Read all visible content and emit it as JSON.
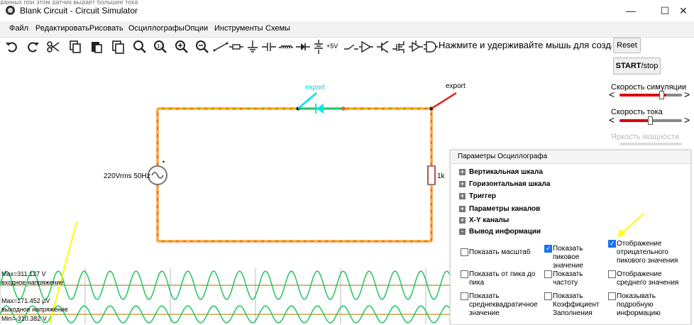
{
  "window": {
    "background_text": "данных при этом датчик выдаёт большее тока",
    "title": "Blank Circuit - Circuit Simulator",
    "controls": [
      "—",
      "☐",
      "✕"
    ]
  },
  "menu": [
    "Файл",
    "Редактировать",
    "Рисовать",
    "Осциллографы",
    "Опции",
    "Инструменты",
    "Схемы"
  ],
  "toolbar": {
    "icons": [
      "undo-icon",
      "redo-icon",
      "cut-icon",
      "copy-icon",
      "paste-icon",
      "duplicate-icon",
      "search-icon",
      "zoom-fit-icon",
      "zoom-in-icon",
      "zoom-out-icon",
      "wire-icon",
      "resistor-icon",
      "ground-icon",
      "capacitor-icon",
      "inductor-icon",
      "diode-icon",
      "voltage-source-icon",
      "rail-icon",
      "switch-icon",
      "buffer-icon",
      "transistor-icon",
      "mosfet-icon",
      "and-gate-icon"
    ],
    "rail_label": "+5V",
    "hint": "Нажмите и удерживайте мышь для создания"
  },
  "side": {
    "reset": "Reset",
    "start_bold": "START",
    "start_rest": "/stop",
    "sim_speed_label": "Скорость симуляции",
    "sim_speed_level": 0.75,
    "current_speed_label": "Скорость тока",
    "current_speed_level": 0.5,
    "power_label": "Яркость мощности"
  },
  "circuit": {
    "source_label": "220Vrms 50Hz",
    "resistor_label": "1k",
    "export_label_1": "export",
    "export_label_2": "export",
    "colors": {
      "wire_dashed": "#e0c000",
      "wire_red": "#e02020",
      "highlight_cyan": "#00e5e5",
      "annotation_yellow": "#ffff00"
    }
  },
  "scope_panel": {
    "title": "Параметры Осциллографа",
    "sections": [
      {
        "sign": "+",
        "label": "Вертикальная шкала"
      },
      {
        "sign": "+",
        "label": "Горизонтальная шкала"
      },
      {
        "sign": "+",
        "label": "Триггер"
      },
      {
        "sign": "+",
        "label": "Параметры каналов"
      },
      {
        "sign": "+",
        "label": "X-Y каналы"
      },
      {
        "sign": "-",
        "label": "Вывод информации"
      }
    ],
    "options": [
      {
        "label": "Показать масштаб",
        "checked": false
      },
      {
        "label": "Показать пиковое значение",
        "checked": true
      },
      {
        "label": "Отображение отрицательного пикового значения",
        "checked": true
      },
      {
        "label": "Показать от пика до пика",
        "checked": false
      },
      {
        "label": "Показать частоту",
        "checked": false
      },
      {
        "label": "Отображение среднего значения",
        "checked": false
      },
      {
        "label": "Показать среднеквадратичное значение",
        "checked": false
      },
      {
        "label": "Показать Коэффициент Заполнения",
        "checked": false
      },
      {
        "label": "Показывать подробную информацию",
        "checked": false
      }
    ]
  },
  "scope": {
    "ch1_max": "Max=311.127 V",
    "ch1_name": "входное напряжение",
    "ch2_max": "Max=171.452 µV",
    "ch2_name": "выходное напряжение",
    "ch2_min": "Min=-310.382 V"
  }
}
